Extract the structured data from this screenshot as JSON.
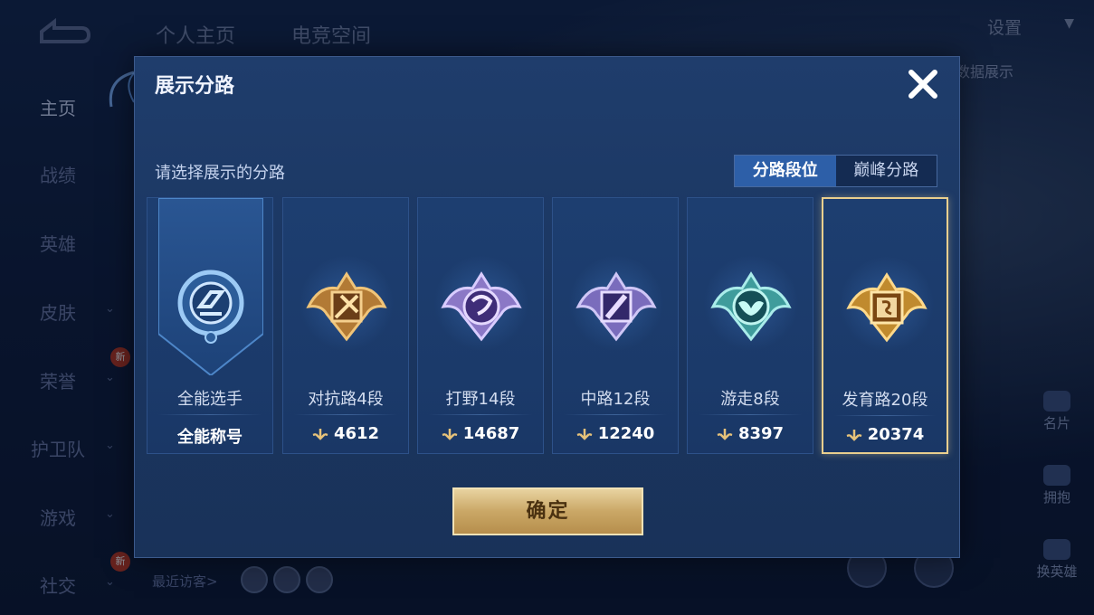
{
  "background": {
    "top_tabs": [
      "个人主页",
      "电竞空间"
    ],
    "settings_label": "设置",
    "right_note": "和数据展示",
    "sidebar": [
      {
        "label": "主页",
        "active": true,
        "chevron": false,
        "new": false
      },
      {
        "label": "战绩",
        "active": false,
        "chevron": false,
        "new": false
      },
      {
        "label": "英雄",
        "active": false,
        "chevron": false,
        "new": false
      },
      {
        "label": "皮肤",
        "active": false,
        "chevron": true,
        "new": false
      },
      {
        "label": "荣誉",
        "active": false,
        "chevron": true,
        "new": true
      },
      {
        "label": "护卫队",
        "active": false,
        "chevron": true,
        "new": false
      },
      {
        "label": "游戏",
        "active": false,
        "chevron": true,
        "new": false
      },
      {
        "label": "社交",
        "active": false,
        "chevron": true,
        "new": true
      }
    ],
    "new_badge_text": "新",
    "recent_visitors": "最近访客>",
    "right_icons": [
      "名片",
      "拥抱",
      "换英雄"
    ]
  },
  "modal": {
    "title": "展示分路",
    "subtitle": "请选择展示的分路",
    "segment": [
      {
        "label": "分路段位",
        "active": true
      },
      {
        "label": "巅峰分路",
        "active": false
      }
    ],
    "cards": [
      {
        "name": "全能选手",
        "score": "全能称号",
        "kind": "banner",
        "color": "#6fa9e0",
        "selected": false
      },
      {
        "name": "对抗路4段",
        "score": "4612",
        "kind": "lane",
        "color": "#d9a357",
        "glyph": "sword-icon",
        "selected": false
      },
      {
        "name": "打野14段",
        "score": "14687",
        "kind": "lane",
        "color": "#b49ee8",
        "glyph": "dragon-icon",
        "selected": false
      },
      {
        "name": "中路12段",
        "score": "12240",
        "kind": "lane",
        "color": "#a894e0",
        "glyph": "staff-icon",
        "selected": false
      },
      {
        "name": "游走8段",
        "score": "8397",
        "kind": "lane",
        "color": "#69d2cf",
        "glyph": "wings-icon",
        "selected": false
      },
      {
        "name": "发育路20段",
        "score": "20374",
        "kind": "lane",
        "color": "#e0b45a",
        "glyph": "scroll-icon",
        "selected": true
      }
    ],
    "confirm_label": "确定"
  }
}
